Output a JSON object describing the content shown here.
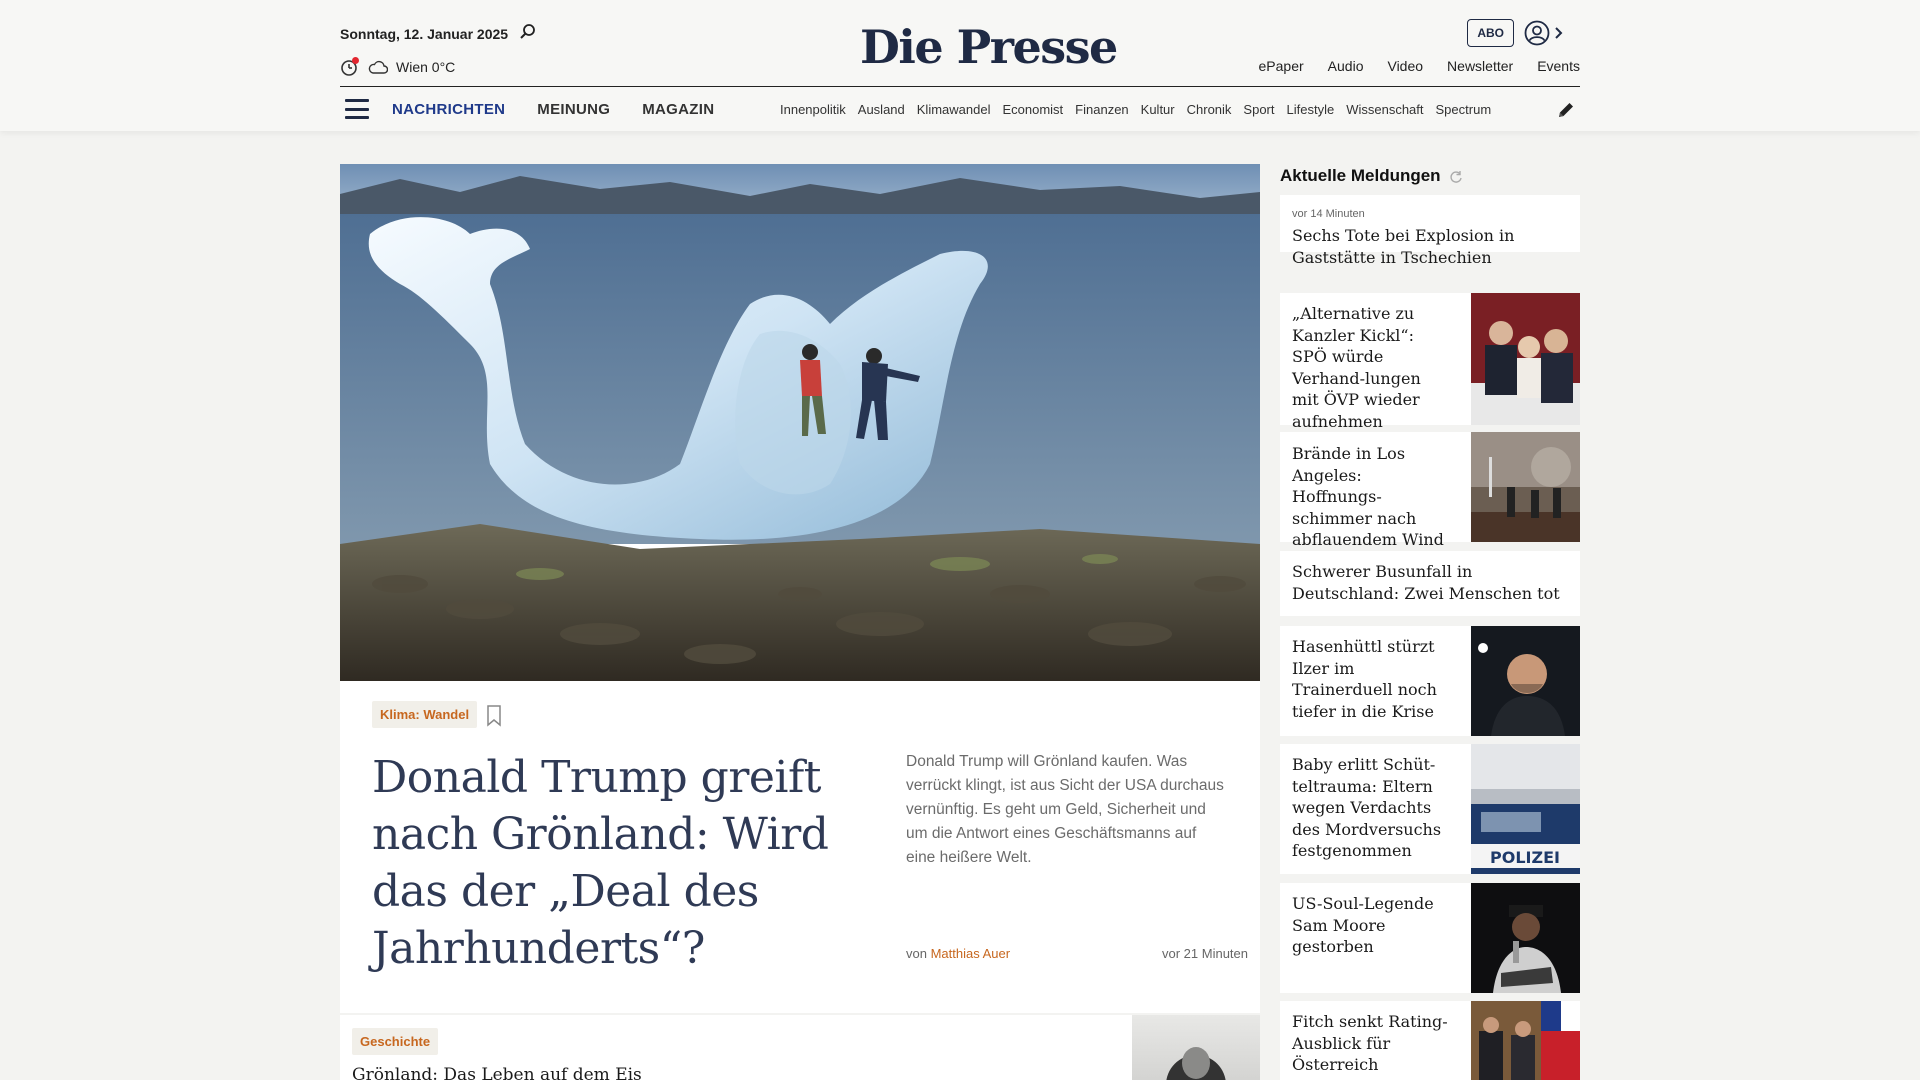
{
  "header": {
    "date": "Sonntag, 12. Januar 2025",
    "weather": "Wien 0°C",
    "logo": "Die Presse",
    "abo_label": "ABO",
    "top_links": [
      "ePaper",
      "Audio",
      "Video",
      "Newsletter",
      "Events"
    ],
    "main_nav": [
      "NACHRICHTEN",
      "MEINUNG",
      "MAGAZIN"
    ],
    "sub_nav": [
      "Innenpolitik",
      "Ausland",
      "Klimawandel",
      "Economist",
      "Finanzen",
      "Kultur",
      "Chronik",
      "Sport",
      "Lifestyle",
      "Wissenschaft",
      "Spectrum"
    ]
  },
  "lead": {
    "tag": "Klima: Wandel",
    "headline": "Donald Trump greift nach Grönland: Wird das der „Deal des Jahrhunderts“?",
    "teaser": "Donald Trump will Grönland kaufen. Was verrückt klingt, ist aus Sicht der USA durchaus vernünftig. Es geht um Geld, Sicherheit und um die Antwort eines Geschäftsmanns auf eine heißere Welt.",
    "byline_prefix": "von",
    "author": "Matthias Auer",
    "time": "vor 21 Minuten"
  },
  "second": {
    "tag": "Geschichte",
    "title": "Grönland: Das Leben auf dem Eis"
  },
  "sidebar": {
    "title": "Aktuelle Meldungen",
    "items": [
      {
        "meta": "vor 14 Minuten",
        "title": "Sechs Tote bei Explosion in Gaststätte in Tschechien"
      },
      {
        "title": "„Alternative zu Kanzler Kickl“: SPÖ würde Verhand-lungen mit ÖVP wieder aufnehmen"
      },
      {
        "title": "Brände in Los Angeles: Hoffnungs-schimmer nach abflauendem Wind"
      },
      {
        "title": "Schwerer Busunfall in Deutschland: Zwei Menschen tot"
      },
      {
        "title": "Hasenhüttl stürzt Ilzer im Trainerduell noch tiefer in die Krise"
      },
      {
        "title": "Baby erlitt Schüt-teltrauma: Eltern wegen Verdachts des Mordversuchs festgenommen",
        "image_text": "POLIZEI"
      },
      {
        "title": "US-Soul-Legende Sam Moore gestorben"
      },
      {
        "title": "Fitch senkt Rating-Ausblick für Österreich"
      }
    ]
  },
  "colors": {
    "brand": "#1f2a44",
    "accent": "#c7671f",
    "nav_active": "#1f3a8a"
  }
}
